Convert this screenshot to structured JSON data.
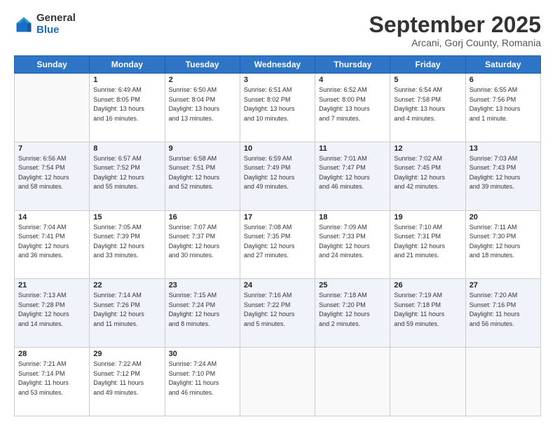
{
  "logo": {
    "general": "General",
    "blue": "Blue"
  },
  "header": {
    "month": "September 2025",
    "location": "Arcani, Gorj County, Romania"
  },
  "days_of_week": [
    "Sunday",
    "Monday",
    "Tuesday",
    "Wednesday",
    "Thursday",
    "Friday",
    "Saturday"
  ],
  "weeks": [
    [
      {
        "day": "",
        "info": ""
      },
      {
        "day": "1",
        "info": "Sunrise: 6:49 AM\nSunset: 8:05 PM\nDaylight: 13 hours\nand 16 minutes."
      },
      {
        "day": "2",
        "info": "Sunrise: 6:50 AM\nSunset: 8:04 PM\nDaylight: 13 hours\nand 13 minutes."
      },
      {
        "day": "3",
        "info": "Sunrise: 6:51 AM\nSunset: 8:02 PM\nDaylight: 13 hours\nand 10 minutes."
      },
      {
        "day": "4",
        "info": "Sunrise: 6:52 AM\nSunset: 8:00 PM\nDaylight: 13 hours\nand 7 minutes."
      },
      {
        "day": "5",
        "info": "Sunrise: 6:54 AM\nSunset: 7:58 PM\nDaylight: 13 hours\nand 4 minutes."
      },
      {
        "day": "6",
        "info": "Sunrise: 6:55 AM\nSunset: 7:56 PM\nDaylight: 13 hours\nand 1 minute."
      }
    ],
    [
      {
        "day": "7",
        "info": "Sunrise: 6:56 AM\nSunset: 7:54 PM\nDaylight: 12 hours\nand 58 minutes."
      },
      {
        "day": "8",
        "info": "Sunrise: 6:57 AM\nSunset: 7:52 PM\nDaylight: 12 hours\nand 55 minutes."
      },
      {
        "day": "9",
        "info": "Sunrise: 6:58 AM\nSunset: 7:51 PM\nDaylight: 12 hours\nand 52 minutes."
      },
      {
        "day": "10",
        "info": "Sunrise: 6:59 AM\nSunset: 7:49 PM\nDaylight: 12 hours\nand 49 minutes."
      },
      {
        "day": "11",
        "info": "Sunrise: 7:01 AM\nSunset: 7:47 PM\nDaylight: 12 hours\nand 46 minutes."
      },
      {
        "day": "12",
        "info": "Sunrise: 7:02 AM\nSunset: 7:45 PM\nDaylight: 12 hours\nand 42 minutes."
      },
      {
        "day": "13",
        "info": "Sunrise: 7:03 AM\nSunset: 7:43 PM\nDaylight: 12 hours\nand 39 minutes."
      }
    ],
    [
      {
        "day": "14",
        "info": "Sunrise: 7:04 AM\nSunset: 7:41 PM\nDaylight: 12 hours\nand 36 minutes."
      },
      {
        "day": "15",
        "info": "Sunrise: 7:05 AM\nSunset: 7:39 PM\nDaylight: 12 hours\nand 33 minutes."
      },
      {
        "day": "16",
        "info": "Sunrise: 7:07 AM\nSunset: 7:37 PM\nDaylight: 12 hours\nand 30 minutes."
      },
      {
        "day": "17",
        "info": "Sunrise: 7:08 AM\nSunset: 7:35 PM\nDaylight: 12 hours\nand 27 minutes."
      },
      {
        "day": "18",
        "info": "Sunrise: 7:09 AM\nSunset: 7:33 PM\nDaylight: 12 hours\nand 24 minutes."
      },
      {
        "day": "19",
        "info": "Sunrise: 7:10 AM\nSunset: 7:31 PM\nDaylight: 12 hours\nand 21 minutes."
      },
      {
        "day": "20",
        "info": "Sunrise: 7:11 AM\nSunset: 7:30 PM\nDaylight: 12 hours\nand 18 minutes."
      }
    ],
    [
      {
        "day": "21",
        "info": "Sunrise: 7:13 AM\nSunset: 7:28 PM\nDaylight: 12 hours\nand 14 minutes."
      },
      {
        "day": "22",
        "info": "Sunrise: 7:14 AM\nSunset: 7:26 PM\nDaylight: 12 hours\nand 11 minutes."
      },
      {
        "day": "23",
        "info": "Sunrise: 7:15 AM\nSunset: 7:24 PM\nDaylight: 12 hours\nand 8 minutes."
      },
      {
        "day": "24",
        "info": "Sunrise: 7:16 AM\nSunset: 7:22 PM\nDaylight: 12 hours\nand 5 minutes."
      },
      {
        "day": "25",
        "info": "Sunrise: 7:18 AM\nSunset: 7:20 PM\nDaylight: 12 hours\nand 2 minutes."
      },
      {
        "day": "26",
        "info": "Sunrise: 7:19 AM\nSunset: 7:18 PM\nDaylight: 11 hours\nand 59 minutes."
      },
      {
        "day": "27",
        "info": "Sunrise: 7:20 AM\nSunset: 7:16 PM\nDaylight: 11 hours\nand 56 minutes."
      }
    ],
    [
      {
        "day": "28",
        "info": "Sunrise: 7:21 AM\nSunset: 7:14 PM\nDaylight: 11 hours\nand 53 minutes."
      },
      {
        "day": "29",
        "info": "Sunrise: 7:22 AM\nSunset: 7:12 PM\nDaylight: 11 hours\nand 49 minutes."
      },
      {
        "day": "30",
        "info": "Sunrise: 7:24 AM\nSunset: 7:10 PM\nDaylight: 11 hours\nand 46 minutes."
      },
      {
        "day": "",
        "info": ""
      },
      {
        "day": "",
        "info": ""
      },
      {
        "day": "",
        "info": ""
      },
      {
        "day": "",
        "info": ""
      }
    ]
  ]
}
